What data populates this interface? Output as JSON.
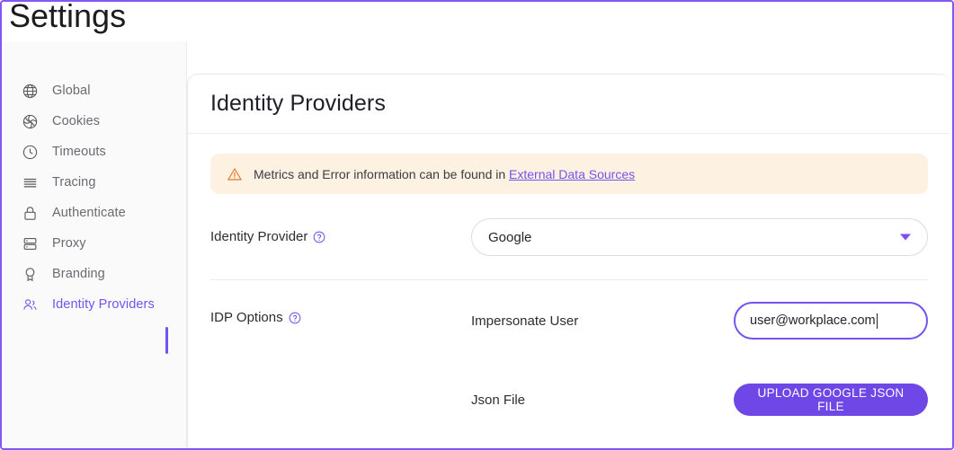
{
  "window": {
    "title": "Settings",
    "accent_color": "#7553ef",
    "border_color": "#8257f5"
  },
  "sidebar": {
    "items": [
      {
        "label": "Global",
        "icon": "globe-icon",
        "active": false
      },
      {
        "label": "Cookies",
        "icon": "cookie-icon",
        "active": false
      },
      {
        "label": "Timeouts",
        "icon": "clock-icon",
        "active": false
      },
      {
        "label": "Tracing",
        "icon": "lines-icon",
        "active": false
      },
      {
        "label": "Authenticate",
        "icon": "lock-icon",
        "active": false
      },
      {
        "label": "Proxy",
        "icon": "server-icon",
        "active": false
      },
      {
        "label": "Branding",
        "icon": "award-icon",
        "active": false
      },
      {
        "label": "Identity Providers",
        "icon": "users-icon",
        "active": true
      }
    ]
  },
  "card": {
    "title": "Identity Providers",
    "banner": {
      "icon": "warning-triangle-icon",
      "text": "Metrics and Error information can be found in",
      "link_text": "External Data Sources",
      "background_color": "#fdf1e2",
      "icon_color": "#e8782a"
    },
    "identity_provider": {
      "label": "Identity Provider",
      "help_icon": "help-circle-icon",
      "selected_value": "Google",
      "dropdown_icon": "chevron-down-icon"
    },
    "idp_options": {
      "label": "IDP Options",
      "help_icon": "help-circle-icon",
      "impersonate_user": {
        "label": "Impersonate User",
        "value": "user@workplace.com",
        "placeholder": "Impersonate User"
      },
      "json_file": {
        "label": "Json File",
        "button_label": "UPLOAD GOOGLE JSON FILE",
        "button_color": "#6f47e6"
      }
    }
  }
}
